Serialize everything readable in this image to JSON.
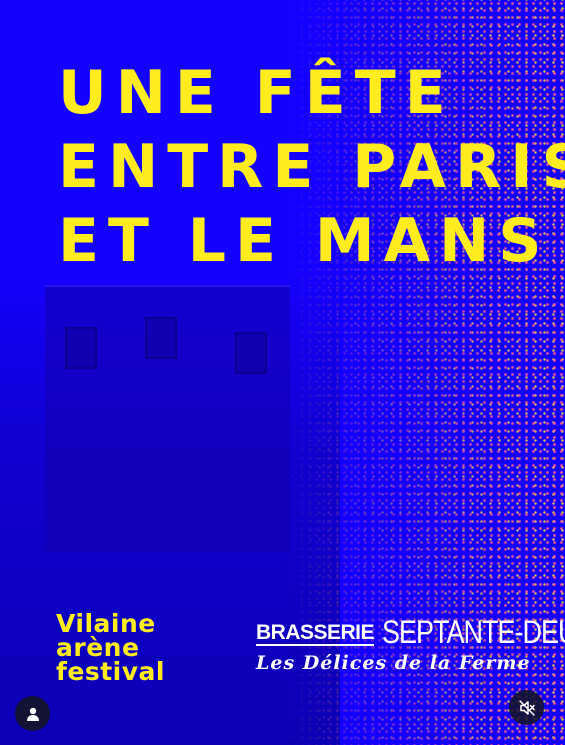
{
  "poster": {
    "headline": [
      "UNE FÊTE",
      "ENTRE PARIS",
      "ET LE MANS"
    ],
    "festival_name": [
      "Vilaine",
      "arène",
      "festival"
    ],
    "sponsor": {
      "brasserie": "BRASSERIE",
      "septante": "SEPTANTE-DEUX",
      "delices": "Les Délices de la Ferme"
    }
  },
  "controls": {
    "avatar_icon": "user-icon",
    "mute_icon": "speaker-muted-icon"
  },
  "colors": {
    "background": "#1400ff",
    "headline": "#ffec1f",
    "sponsor": "#ffffff"
  }
}
